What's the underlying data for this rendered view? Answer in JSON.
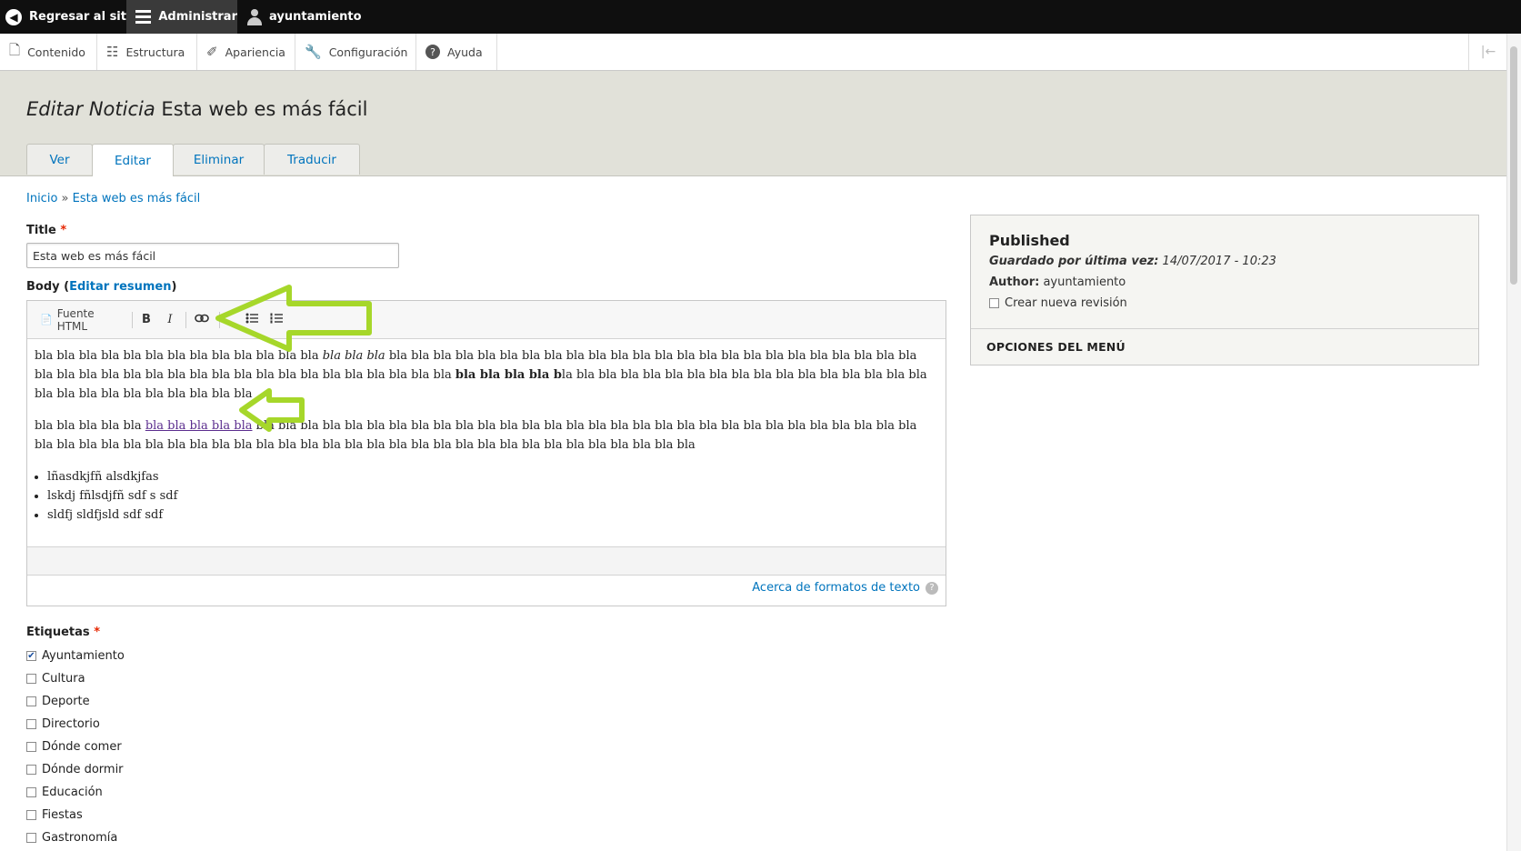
{
  "toolbar": {
    "back_label": "Regresar al sitio",
    "admin_label": "Administrar",
    "user_label": "ayuntamiento"
  },
  "admin_menu": {
    "items": [
      {
        "label": "Contenido",
        "icon": "page-icon"
      },
      {
        "label": "Estructura",
        "icon": "sitemap-icon"
      },
      {
        "label": "Apariencia",
        "icon": "brush-icon"
      },
      {
        "label": "Configuración",
        "icon": "wrench-icon"
      },
      {
        "label": "Ayuda",
        "icon": "help-icon"
      }
    ]
  },
  "page": {
    "title_prefix": "Editar Noticia",
    "title_main": "Esta web es más fácil",
    "tabs": [
      {
        "label": "Ver"
      },
      {
        "label": "Editar",
        "active": true
      },
      {
        "label": "Eliminar"
      },
      {
        "label": "Traducir"
      }
    ]
  },
  "breadcrumb": {
    "home": "Inicio",
    "separator": "»",
    "current": "Esta web es más fácil"
  },
  "form": {
    "title_label": "Title",
    "required_mark": "*",
    "title_value": "Esta web es más fácil",
    "body_label": "Body (",
    "body_summary_link": "Editar resumen",
    "body_label_end": ")",
    "editor_toolbar": {
      "source_label": "Fuente HTML",
      "bold_label": "B",
      "italic_label": "I"
    },
    "editor_content": {
      "p1_a": "bla bla bla bla bla bla bla bla bla bla bla bla bla ",
      "p1_italic": "bla bla bla",
      "p1_b": " bla bla bla bla bla bla bla bla bla bla bla bla bla bla bla bla bla bla bla bla bla bla bla bla bla bla bla bla bla bla ",
      "p1_c": "bla bla bla bla bla bla bla bla bla bla bla bla bla ",
      "p1_bold": "bla bla bla bla b",
      "p1_d": "la bla bla bla bla bla bla bla bla bla bla bla bla bla bla bla bla bla bla bla bla bla bla bla bla bla bla",
      "p2_a": "bla bla bla bla bla ",
      "p2_link": "bla bla bla bla bla",
      "p2_b": " bla bla bla bla bla bla bla bla bla bla bla bla bla bla bla bla bla bla bla bla bla bla bla bla bla bla bla bla bla bla bla bla bla bla bla bla bla bla bla bla bla bla bla bla bla bla bla bla bla bla bla bla bla bla bla bla bla bla bla bla",
      "list": [
        "lñasdkjfñ alsdkjfas",
        "lskdj fñlsdjfñ  sdf s sdf",
        "sldfj sldfjsld sdf sdf"
      ]
    },
    "formats_link": "Acerca de formatos de texto",
    "tags_label": "Etiquetas",
    "tags": [
      {
        "label": "Ayuntamiento",
        "checked": true
      },
      {
        "label": "Cultura",
        "checked": false
      },
      {
        "label": "Deporte",
        "checked": false
      },
      {
        "label": "Directorio",
        "checked": false
      },
      {
        "label": "Dónde comer",
        "checked": false
      },
      {
        "label": "Dónde dormir",
        "checked": false
      },
      {
        "label": "Educación",
        "checked": false
      },
      {
        "label": "Fiestas",
        "checked": false
      },
      {
        "label": "Gastronomía",
        "checked": false
      }
    ]
  },
  "sidebar": {
    "status": "Published",
    "saved_label": "Guardado por última vez:",
    "saved_value": "14/07/2017 - 10:23",
    "author_label": "Author:",
    "author_value": "ayuntamiento",
    "new_revision_label": "Crear nueva revisión",
    "menu_options": "OPCIONES DEL MENÚ"
  },
  "colors": {
    "link": "#0074bd",
    "annotation_arrow": "#a6d72a",
    "toolbar_bg": "#0f0f0f",
    "header_bg": "#e1e1d9"
  }
}
